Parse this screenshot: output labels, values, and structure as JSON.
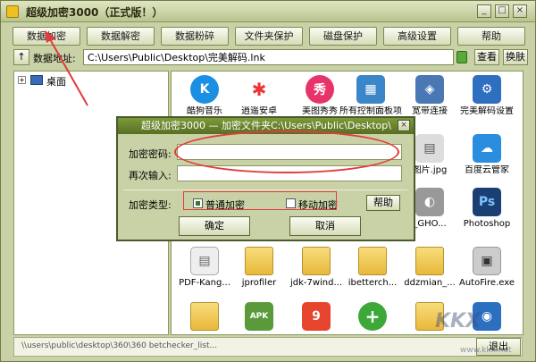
{
  "window": {
    "title": "超级加密3000（正式版！）",
    "controls": {
      "minimize": "_",
      "maximize": "□",
      "close": "×"
    }
  },
  "toolbar": {
    "buttons": [
      {
        "label": "数据加密"
      },
      {
        "label": "数据解密"
      },
      {
        "label": "数据粉碎"
      },
      {
        "label": "文件夹保护"
      },
      {
        "label": "磁盘保护"
      },
      {
        "label": "高级设置"
      },
      {
        "label": "帮助"
      }
    ]
  },
  "address": {
    "up": "↑",
    "label": "数据地址:",
    "value": "C:\\Users\\Public\\Desktop\\完美解码.lnk",
    "view_label": "查看",
    "skin_label": "换肤"
  },
  "tree": {
    "expand": "+",
    "root_label": "桌面"
  },
  "files": {
    "row1": [
      {
        "label": "酷狗音乐",
        "glyph": "K",
        "color": "#1a8fe3"
      },
      {
        "label": "逍遥安卓",
        "glyph": "✱",
        "color": "#ffffff"
      },
      {
        "label": "美图秀秀",
        "glyph": "秀",
        "color": "#e8336a"
      },
      {
        "label": "所有控制面板项",
        "glyph": "▦",
        "color": "#3b86c8"
      },
      {
        "label": "宽带连接",
        "glyph": "◈",
        "color": "#4a78b4"
      },
      {
        "label": "完美解码设置",
        "glyph": "⚙",
        "color": "#2f6fc0"
      }
    ],
    "row2": [
      {
        "label": "图片.jpg",
        "glyph": "▤",
        "color": "#dddddd"
      },
      {
        "label": "百度云管家",
        "glyph": "☁",
        "color": "#2a8de0"
      }
    ],
    "row3": [
      {
        "label": "_GHO...",
        "glyph": "◐",
        "color": "#999999"
      },
      {
        "label": "Photoshop",
        "glyph": "Ps",
        "color": "#1b3f73"
      }
    ],
    "row4": [
      {
        "label": "PDF-Kang...",
        "glyph": "▤",
        "color": "#eeeeee"
      },
      {
        "label": "jprofiler"
      },
      {
        "label": "jdk-7wind..."
      },
      {
        "label": "ibetterch..."
      },
      {
        "label": "ddzmian_..."
      },
      {
        "label": "AutoFire.exe",
        "glyph": "▣",
        "color": "#cccccc"
      }
    ],
    "row5": [
      {
        "label": "",
        "glyph": "",
        "color": ""
      },
      {
        "label": "",
        "glyph": "APK",
        "color": "#5a9a3a"
      },
      {
        "label": "",
        "glyph": "9",
        "color": "#e6442c"
      },
      {
        "label": "",
        "glyph": "+",
        "color": "#3ca83a"
      },
      {
        "label": "",
        "glyph": "",
        "color": ""
      },
      {
        "label": "",
        "glyph": "◉",
        "color": "#2a6fc0"
      }
    ]
  },
  "status": {
    "text": "\\\\users\\public\\desktop\\360\\360 betchecker_list...",
    "exit_label": "退出"
  },
  "dialog": {
    "title": "超级加密3000 — 加密文件夹C:\\Users\\Public\\Desktop\\",
    "close": "×",
    "password_label": "加密密码:",
    "password_value": "",
    "confirm_label": "再次输入:",
    "confirm_value": "",
    "type_label": "加密类型:",
    "option_normal": "普通加密",
    "option_mobile": "移动加密",
    "help_label": "帮助",
    "ok_label": "确定",
    "cancel_label": "取消"
  },
  "watermark": {
    "brand": "KKX",
    "url": "www.kkx.net"
  },
  "colors": {
    "chrome": "#c9d2a7",
    "dialog_title": "#566f22",
    "annotation": "#e23b3b"
  }
}
